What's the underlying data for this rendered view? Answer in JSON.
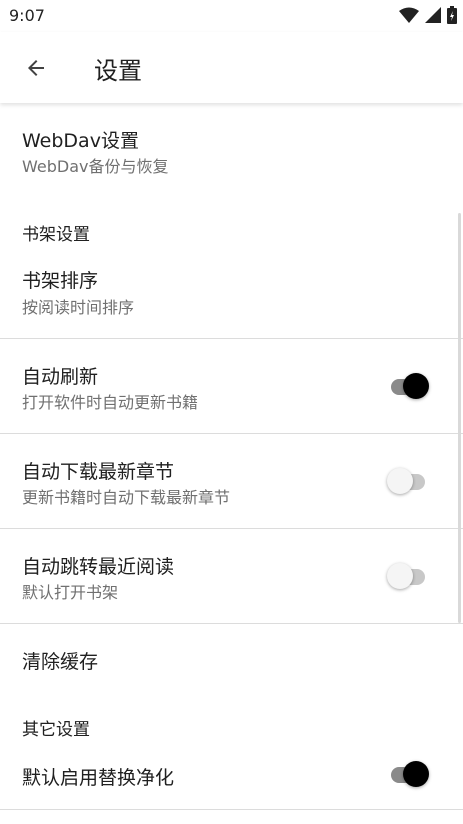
{
  "status": {
    "time": "9:07"
  },
  "appbar": {
    "title": "设置"
  },
  "items": {
    "webdav": {
      "title": "WebDav设置",
      "subtitle": "WebDav备份与恢复"
    },
    "bookshelf_section": "书架设置",
    "sort": {
      "title": "书架排序",
      "subtitle": "按阅读时间排序"
    },
    "auto_refresh": {
      "title": "自动刷新",
      "subtitle": "打开软件时自动更新书籍",
      "enabled": true
    },
    "auto_download": {
      "title": "自动下载最新章节",
      "subtitle": "更新书籍时自动下载最新章节",
      "enabled": false
    },
    "auto_jump": {
      "title": "自动跳转最近阅读",
      "subtitle": "默认打开书架",
      "enabled": false
    },
    "clear_cache": {
      "title": "清除缓存"
    },
    "other_section": "其它设置",
    "replace_purify": {
      "title": "默认启用替换净化",
      "enabled": true
    }
  }
}
